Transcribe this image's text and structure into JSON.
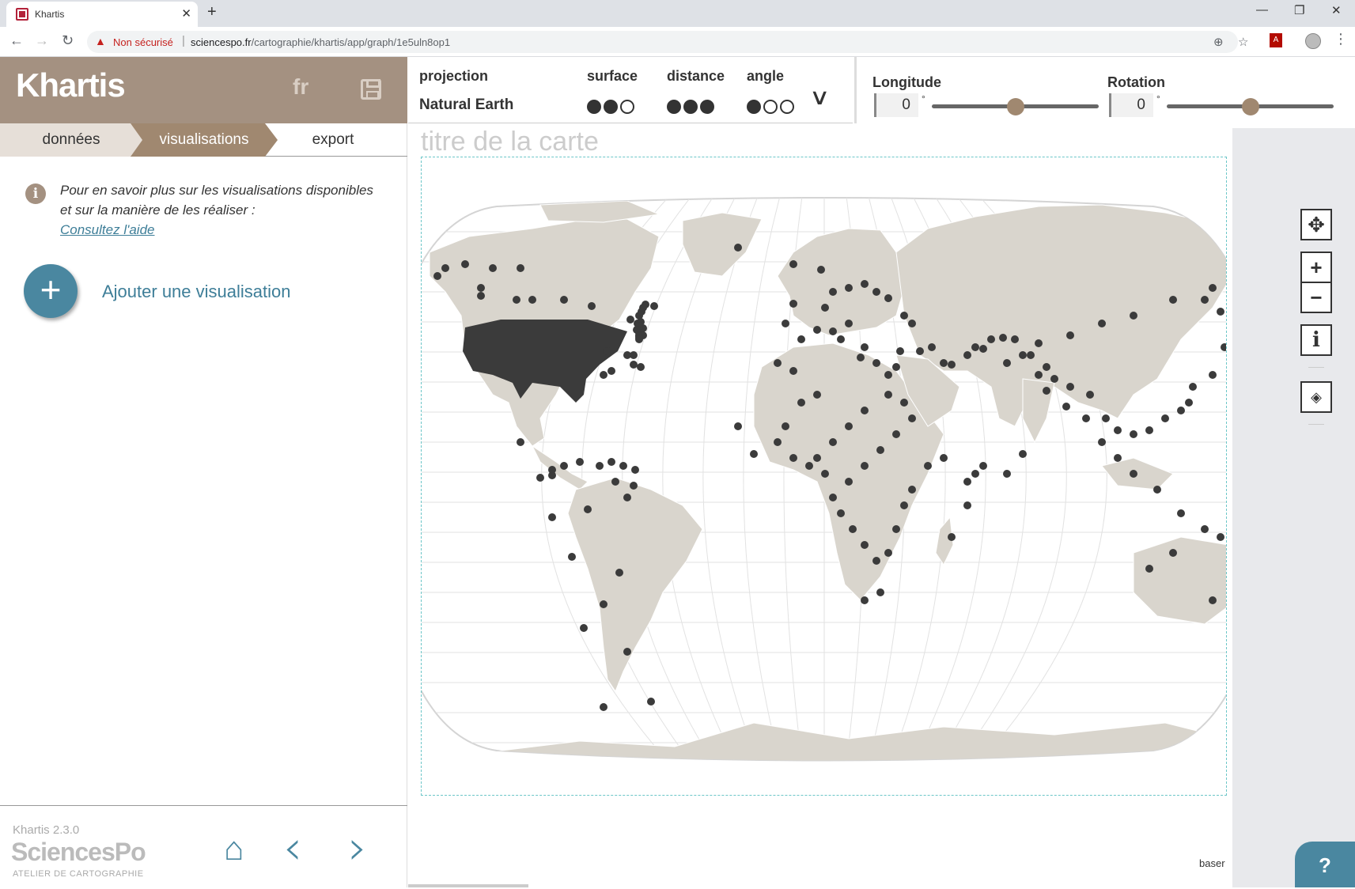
{
  "browser": {
    "tab_title": "Khartis",
    "insecure_label": "Non sécurisé",
    "url_domain": "sciencespo.fr",
    "url_path": "/cartographie/khartis/app/graph/1e5uln8op1",
    "icons": [
      "back-icon",
      "forward-icon",
      "reload-icon",
      "zoom-icon",
      "star-icon",
      "pdf-icon",
      "profile-icon",
      "menu-icon"
    ]
  },
  "app": {
    "logo": "Khartis",
    "lang": "fr",
    "steps": [
      "données",
      "visualisations",
      "export"
    ],
    "active_step": "visualisations",
    "info_text": "Pour en savoir plus sur les visualisations disponibles et sur la manière de les réaliser :",
    "info_link": "Consultez l'aide",
    "add_visualisation": "Ajouter une visualisation",
    "version": "Khartis 2.3.0",
    "org": "SciencesPo",
    "org_sub": "ATELIER DE CARTOGRAPHIE"
  },
  "projection": {
    "header": "projection",
    "name": "Natural Earth",
    "criteria": [
      {
        "label": "surface",
        "score": 2
      },
      {
        "label": "distance",
        "score": 3
      },
      {
        "label": "angle",
        "score": 1
      }
    ]
  },
  "controls": {
    "longitude_label": "Longitude",
    "longitude_value": "0",
    "longitude_position": 0.5,
    "rotation_label": "Rotation",
    "rotation_value": "0",
    "rotation_position": 0.5,
    "degree_symbol": "°"
  },
  "map": {
    "title_placeholder": "titre de la carte",
    "credit": "baser",
    "land_color": "#d9d5cd",
    "point_color": "#3b3b3b"
  },
  "colors": {
    "brand": "#a49181",
    "accent": "#4a87a0",
    "step_active": "#a08870"
  },
  "help_label": "?"
}
